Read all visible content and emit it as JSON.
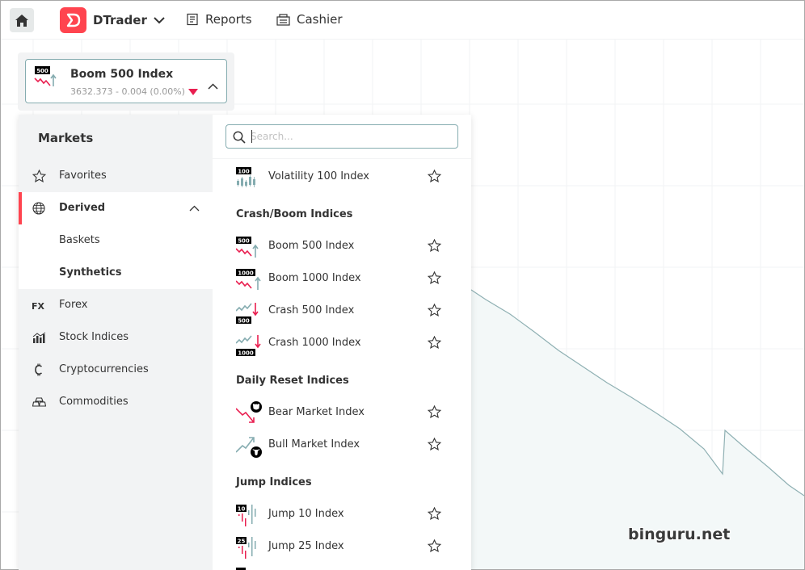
{
  "header": {
    "brand_name": "DTrader",
    "nav_reports": "Reports",
    "nav_cashier": "Cashier",
    "brand_color": "#ff444f"
  },
  "selector": {
    "symbol_name": "Boom 500 Index",
    "price_text": "3632.373 - 0.004 (0.00%)",
    "icon_badge": "500"
  },
  "sidebar": {
    "title": "Markets",
    "items": [
      {
        "label": "Favorites",
        "icon": "star-icon"
      },
      {
        "label": "Derived",
        "icon": "globe-icon"
      },
      {
        "label": "Baskets",
        "icon": ""
      },
      {
        "label": "Synthetics",
        "icon": ""
      },
      {
        "label": "Forex",
        "icon": "fx-icon"
      },
      {
        "label": "Stock Indices",
        "icon": "stock-indices-icon"
      },
      {
        "label": "Cryptocurrencies",
        "icon": "crypto-icon"
      },
      {
        "label": "Commodities",
        "icon": "commodities-icon"
      }
    ]
  },
  "search": {
    "placeholder": "Search..."
  },
  "list": {
    "top_item": {
      "label": "Volatility 100 Index",
      "badge": "100"
    },
    "groups": [
      {
        "title": "Crash/Boom Indices",
        "items": [
          {
            "label": "Boom 500 Index",
            "badge": "500"
          },
          {
            "label": "Boom 1000 Index",
            "badge": "1000"
          },
          {
            "label": "Crash 500 Index",
            "badge": "500"
          },
          {
            "label": "Crash 1000 Index",
            "badge": "1000"
          }
        ]
      },
      {
        "title": "Daily Reset Indices",
        "items": [
          {
            "label": "Bear Market Index"
          },
          {
            "label": "Bull Market Index"
          }
        ]
      },
      {
        "title": "Jump Indices",
        "items": [
          {
            "label": "Jump 10 Index",
            "badge": "10"
          },
          {
            "label": "Jump 25 Index",
            "badge": "25"
          }
        ]
      }
    ]
  },
  "watermark": "binguru.net",
  "colors": {
    "accent_red": "#ff444f",
    "down_red": "#e91f50",
    "border_teal": "#85acb0",
    "chart_line": "#8fb0b3"
  }
}
